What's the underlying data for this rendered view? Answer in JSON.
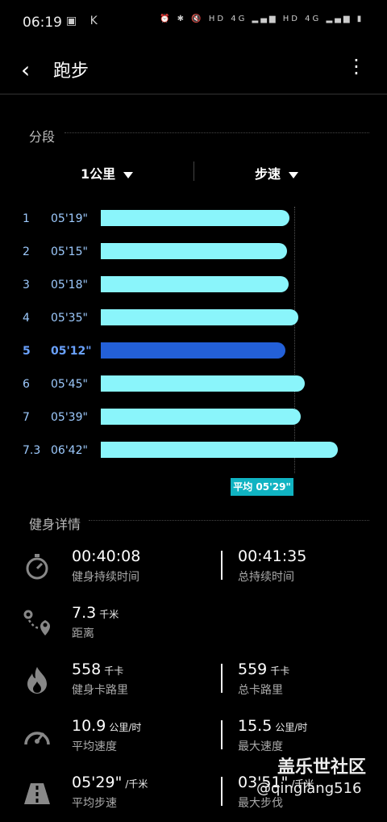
{
  "status_bar": {
    "time": "06:19",
    "left_icons": "▣ K",
    "right_icons": "⏰ ✱ 🔇 HD 4G ▂▄▆ HD 4G ▂▄▆ ▮"
  },
  "app_bar": {
    "title": "跑步",
    "back_icon": "back-icon",
    "more_icon": "more-icon"
  },
  "splits": {
    "section_title": "分段",
    "unit_filter": "1公里",
    "metric_filter": "步速",
    "rows": [
      {
        "index": "1",
        "pace": "05'19\"",
        "pace_seconds": 319,
        "highlight": false
      },
      {
        "index": "2",
        "pace": "05'15\"",
        "pace_seconds": 315,
        "highlight": false
      },
      {
        "index": "3",
        "pace": "05'18\"",
        "pace_seconds": 318,
        "highlight": false
      },
      {
        "index": "4",
        "pace": "05'35\"",
        "pace_seconds": 335,
        "highlight": false
      },
      {
        "index": "5",
        "pace": "05'12\"",
        "pace_seconds": 312,
        "highlight": true
      },
      {
        "index": "6",
        "pace": "05'45\"",
        "pace_seconds": 345,
        "highlight": false
      },
      {
        "index": "7",
        "pace": "05'39\"",
        "pace_seconds": 339,
        "highlight": false
      },
      {
        "index": "7.3",
        "pace": "06'42\"",
        "pace_seconds": 402,
        "highlight": false
      }
    ],
    "average_label": "平均 05'29\""
  },
  "details": {
    "section_title": "健身详情",
    "duration": {
      "active_value": "00:40:08",
      "active_label": "健身持续时间",
      "total_value": "00:41:35",
      "total_label": "总持续时间"
    },
    "distance": {
      "value": "7.3",
      "unit": "千米",
      "label": "距离"
    },
    "calories": {
      "active_value": "558",
      "active_unit": "千卡",
      "active_label": "健身卡路里",
      "total_value": "559",
      "total_unit": "千卡",
      "total_label": "总卡路里"
    },
    "speed": {
      "avg_value": "10.9",
      "avg_unit": "公里/时",
      "avg_label": "平均速度",
      "max_value": "15.5",
      "max_unit": "公里/时",
      "max_label": "最大速度"
    },
    "pace": {
      "avg_value": "05'29\"",
      "avg_unit": "/千米",
      "avg_label": "平均步速",
      "max_value": "03'51\"",
      "max_unit": "/千米",
      "max_label": "最大步伐"
    }
  },
  "watermark": {
    "line1": "盖乐世社区",
    "line2": "@qinglang516"
  },
  "colors": {
    "bar": "#8af5fb",
    "highlight_bar": "#2360d8",
    "badge": "#10b3c2"
  }
}
